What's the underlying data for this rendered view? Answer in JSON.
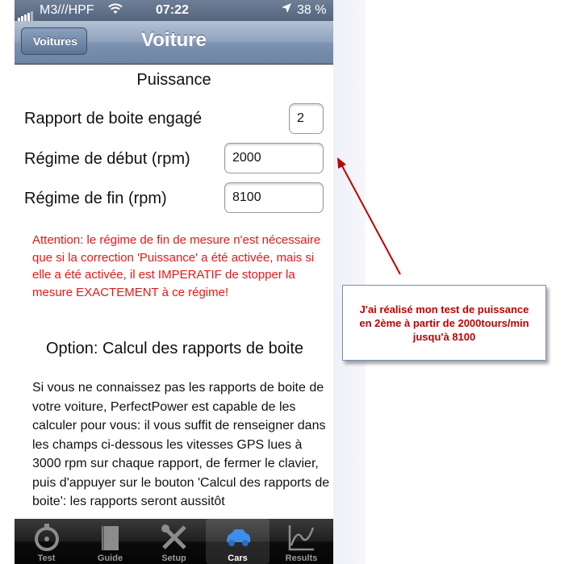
{
  "status_bar": {
    "carrier": "M3///HPF",
    "time": "07:22",
    "battery": "38 %",
    "icons": [
      "signal-icon",
      "wifi-icon",
      "location-icon"
    ]
  },
  "nav": {
    "back_label": "Voitures",
    "title": "Voiture"
  },
  "form": {
    "section_title": "Puissance",
    "gear_label": "Rapport de boite engagé",
    "gear_value": "2",
    "start_rpm_label": "Régime de début (rpm)",
    "start_rpm_value": "2000",
    "end_rpm_label": "Régime de fin (rpm)",
    "end_rpm_value": "8100"
  },
  "warning": "Attention: le régime de fin de mesure n'est nécessaire que si la correction 'Puissance' a été activée, mais si elle a été activée, il est IMPERATIF de stopper la mesure EXACTEMENT à ce régime!",
  "option": {
    "title": "Option: Calcul des rapports de boite",
    "text": "Si vous ne connaissez pas les rapports de boite de votre voiture, PerfectPower est capable de les calculer pour vous: il vous suffit de renseigner dans les champs ci-dessous les vitesses GPS lues à 3000 rpm sur chaque rapport, de fermer le clavier, puis d'appuyer sur le bouton 'Calcul des rapports de boite': les rapports seront aussitôt"
  },
  "tabs": [
    {
      "label": "Test",
      "icon": "stopwatch-icon"
    },
    {
      "label": "Guide",
      "icon": "book-icon"
    },
    {
      "label": "Setup",
      "icon": "tools-icon"
    },
    {
      "label": "Cars",
      "icon": "car-icon",
      "active": true
    },
    {
      "label": "Results",
      "icon": "chart-icon"
    }
  ],
  "annotation": {
    "line1": "J'ai réalisé mon test de puissance",
    "line2": "en 2ème à partir de 2000tours/min",
    "line3": "jusqu'à 8100",
    "color": "#c00000"
  }
}
